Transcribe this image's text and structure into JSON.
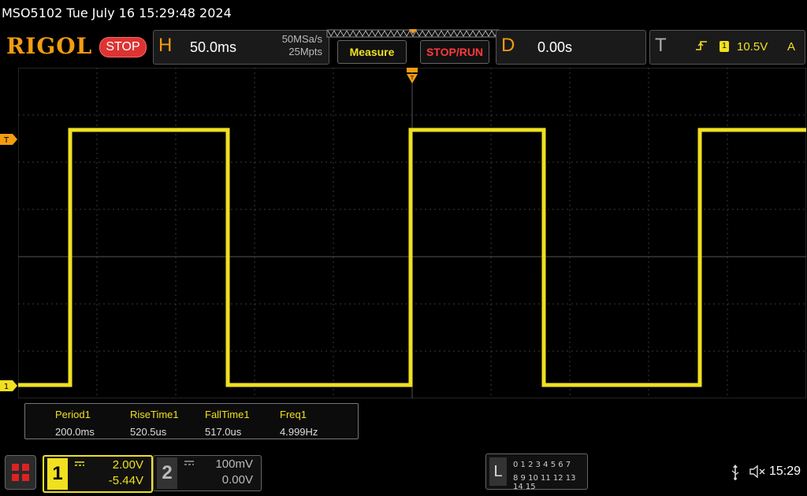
{
  "title_bar": {
    "text": "MSO5102  Tue July 16 15:29:48 2024"
  },
  "toolbar": {
    "logo": "RIGOL",
    "run_state": "STOP",
    "horizontal": {
      "letter": "H",
      "timebase": "50.0ms",
      "sample_rate": "50MSa/s",
      "memory_depth": "25Mpts"
    },
    "measure_label": "Measure",
    "stoprun_label": "STOP/RUN",
    "delay": {
      "letter": "D",
      "value": "0.00s"
    },
    "trigger": {
      "letter": "T",
      "source": "1",
      "level": "10.5V",
      "mode": "A"
    }
  },
  "markers": {
    "trigger_level": "T",
    "ch1_ground": "1"
  },
  "measurements": [
    {
      "name": "Period1",
      "value": "200.0ms"
    },
    {
      "name": "RiseTime1",
      "value": "520.5us"
    },
    {
      "name": "FallTime1",
      "value": "517.0us"
    },
    {
      "name": "Freq1",
      "value": "4.999Hz"
    }
  ],
  "channels": [
    {
      "number": "1",
      "scale": "2.00V",
      "offset": "-5.44V",
      "active": true
    },
    {
      "number": "2",
      "scale": "100mV",
      "offset": "0.00V",
      "active": false
    }
  ],
  "logic": {
    "letter": "L",
    "row1": "0 1 2 3   4 5 6 7",
    "row2": "8  9 10 11  12 13 14 15"
  },
  "status": {
    "time": "15:29",
    "icons": [
      "usb-icon",
      "sound-muted-icon"
    ]
  },
  "colors": {
    "ch1": "#f0e020",
    "accent": "#f39c12",
    "stop": "#dd3333"
  }
}
